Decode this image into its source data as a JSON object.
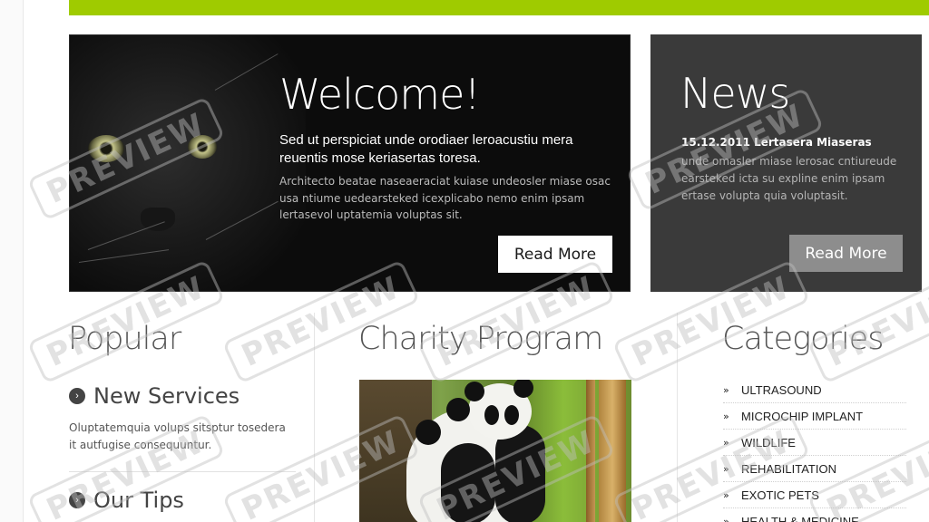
{
  "banner": {
    "title": "Welcome!",
    "lead": "Sed ut perspiciat unde orodiaer leroacustiu mera reuentis mose keriasertas toresa.",
    "text": "Architecto beatae naseaeraciat kuiase undeosler miase osac usa ntiume uedearsteked icexplicabo nemo enim ipsam lertasevol uptatemia voluptas sit.",
    "button": "Read More"
  },
  "news": {
    "title": "News",
    "item_title": "15.12.2011 Lertasera Miaseras",
    "item_text": "unde omasler miase lerosac cntiureude earsteked icta su expline enim ipsam ertase volupta quia voluptasit.",
    "button": "Read More"
  },
  "popular": {
    "title": "Popular",
    "items": [
      {
        "title": "New Services",
        "text": "Oluptatemquia volups sitsptur tosedera it autfugise consequuntur."
      },
      {
        "title": "Our Tips",
        "text": ""
      }
    ]
  },
  "charity": {
    "title": "Charity Program"
  },
  "categories": {
    "title": "Categories",
    "items": [
      "ULTRASOUND",
      "MICROCHIP IMPLANT",
      "WILDLIFE",
      "REHABILITATION",
      "EXOTIC PETS",
      "HEALTH & MEDICINE"
    ]
  },
  "watermark": "PREVIEW",
  "colors": {
    "accent": "#9fcb00",
    "banner_bg": "#0c0c0c",
    "news_bg": "#3a3a3a",
    "news_button": "#8d8d8d"
  },
  "icons": {
    "bullet": "circle-arrow-icon",
    "category": "double-chevron-icon"
  }
}
